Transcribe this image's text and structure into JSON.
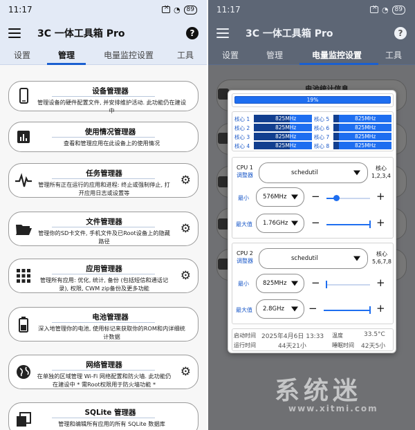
{
  "status": {
    "time": "11:17",
    "battery": "89"
  },
  "app": {
    "title": "3C 一体工具箱 Pro"
  },
  "tabs": [
    "设置",
    "管理",
    "电量监控设置",
    "工具"
  ],
  "left": {
    "cards": [
      {
        "title": "设备管理器",
        "desc": "管理设备的硬件配置文件, 并安排维护活动. 此功能仍在建设中"
      },
      {
        "title": "使用情况管理器",
        "desc": "查看和管理应用在此设备上的使用情况"
      },
      {
        "title": "任务管理器",
        "desc": "管理所有正在运行的应用和进程: 终止或强制停止, 打开应用日志或设置等"
      },
      {
        "title": "文件管理器",
        "desc": "管理你的SD卡文件, 手机文件及已Root设备上的隐藏路径"
      },
      {
        "title": "应用管理器",
        "desc": "管理所有应用: 优化, 统计, 备份 (包括短信和通话记录), 权限, CWM zip备份及更多功能"
      },
      {
        "title": "电池管理器",
        "desc": "深入地管理你的电池, 使用标记来获取你的ROM和内详细统计数据"
      },
      {
        "title": "网络管理器",
        "desc": "在单独的区域管理 Wi-Fi 网络配置和防火墙. 此功能仍在建设中 * 需Root权限用于防火墙功能 *"
      },
      {
        "title": "SQLite 管理器",
        "desc": "管理和编辑所有应用的所有 SQLite 数据库"
      }
    ]
  },
  "right": {
    "bg_title": "电池统计信息",
    "dialog": {
      "progress_label": "19%",
      "progress_value": 0.19,
      "cores": [
        {
          "label": "核心 1",
          "freq": "825MHz",
          "load": 0.62
        },
        {
          "label": "核心 2",
          "freq": "825MHz",
          "load": 0.62
        },
        {
          "label": "核心 3",
          "freq": "825MHz",
          "load": 0.62
        },
        {
          "label": "核心 4",
          "freq": "825MHz",
          "load": 0.62
        },
        {
          "label": "核心 5",
          "freq": "825MHz",
          "load": 0.1
        },
        {
          "label": "核心 6",
          "freq": "825MHz",
          "load": 0.1
        },
        {
          "label": "核心 7",
          "freq": "825MHz",
          "load": 0.1
        },
        {
          "label": "核心 8",
          "freq": "825MHz",
          "load": 0.1
        }
      ],
      "cpu1": {
        "name": "CPU 1",
        "governor_label": "调整器",
        "governor": "schedutil",
        "cores_label": "核心",
        "cores": "1,2,3,4",
        "min_label": "最小",
        "min": "576MHz",
        "min_pos": 0.22,
        "max_label": "最大值",
        "max": "1.76GHz",
        "max_pos": 1.0
      },
      "cpu2": {
        "name": "CPU 2",
        "governor_label": "调整器",
        "governor": "schedutil",
        "cores_label": "核心",
        "cores": "5,6,7,8",
        "min_label": "最小",
        "min": "825MHz",
        "min_pos": 0.0,
        "max_label": "最大值",
        "max": "2.8GHz",
        "max_pos": 1.0
      },
      "footer": {
        "boot_label": "启动时间",
        "boot_value": "2025年4月6日 13:33",
        "temp_label": "温度",
        "temp_value": "33.5°C",
        "run_label": "运行时间",
        "run_value": "44天21小",
        "sleep_label": "睡眠时间",
        "sleep_value": "42天5小"
      }
    }
  },
  "watermark": {
    "text": "系统迷",
    "url": "www.xitmi.com"
  },
  "colors": {
    "accent": "#1e6ef0",
    "appbar_left": "#e3eaf6",
    "overlay": "#6f7073"
  }
}
